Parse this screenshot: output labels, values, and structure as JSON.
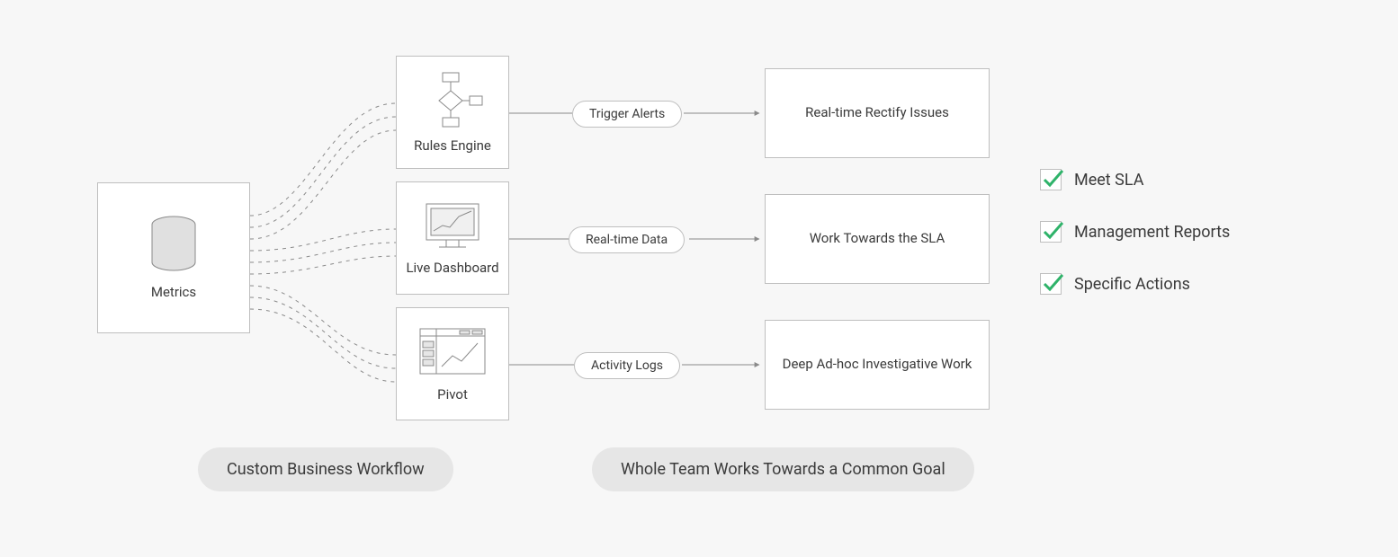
{
  "source": {
    "label": "Metrics",
    "icon": "database-icon"
  },
  "processors": [
    {
      "label": "Rules Engine",
      "icon": "flowchart-icon"
    },
    {
      "label": "Live Dashboard",
      "icon": "dashboard-icon"
    },
    {
      "label": "Pivot",
      "icon": "pivot-icon"
    }
  ],
  "streams": [
    {
      "label": "Trigger Alerts"
    },
    {
      "label": "Real-time Data"
    },
    {
      "label": "Activity Logs"
    }
  ],
  "outcomes": [
    {
      "label": "Real-time Rectify Issues"
    },
    {
      "label": "Work Towards the SLA"
    },
    {
      "label": "Deep Ad-hoc Investigative Work"
    }
  ],
  "checks": [
    {
      "label": "Meet SLA"
    },
    {
      "label": "Management Reports"
    },
    {
      "label": "Specific Actions"
    }
  ],
  "sections": {
    "left": "Custom Business Workflow",
    "right": "Whole Team Works Towards a Common Goal"
  },
  "colors": {
    "stroke": "#8a8a8a",
    "border": "#bfbfbf",
    "check": "#2fb36a"
  }
}
